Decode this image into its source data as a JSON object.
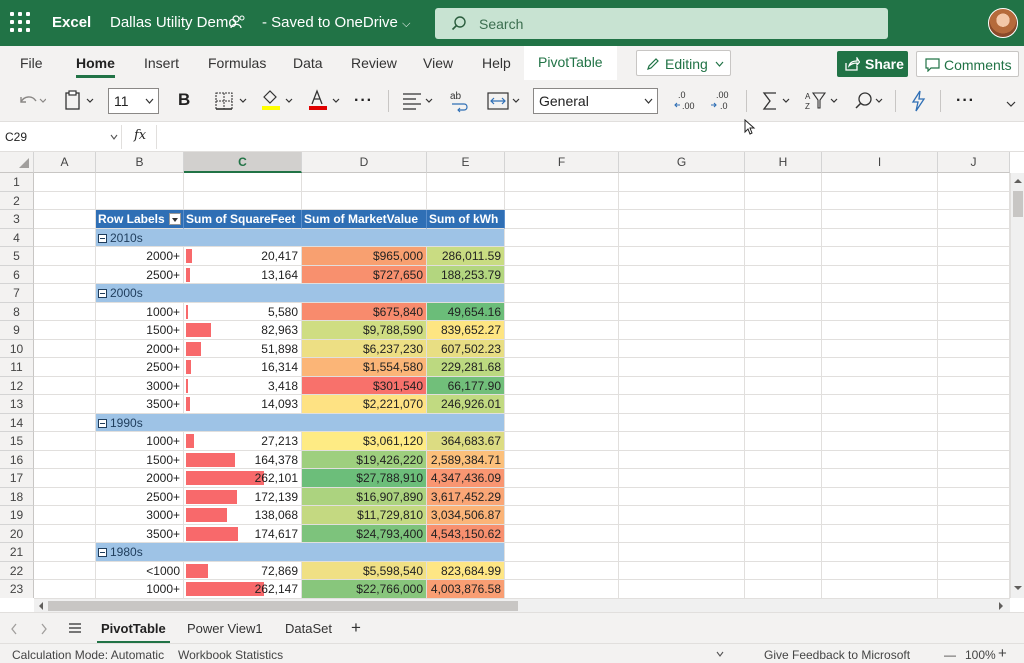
{
  "titlebar": {
    "app_name": "Excel",
    "doc_name": "Dallas Utility Demo",
    "doc_state": "- Saved to OneDrive",
    "search_placeholder": "Search"
  },
  "ribbon": {
    "tabs": [
      "File",
      "Home",
      "Insert",
      "Formulas",
      "Data",
      "Review",
      "View",
      "Help",
      "PivotTable"
    ],
    "active_tab": "Home",
    "editing_label": "Editing",
    "share_label": "Share",
    "comments_label": "Comments"
  },
  "toolbar": {
    "font_size": "11",
    "bold_label": "B",
    "number_format": "General",
    "more_label": "···"
  },
  "formula_bar": {
    "name_box": "C29",
    "fx_label": "fx",
    "formula": ""
  },
  "grid": {
    "columns": [
      "A",
      "B",
      "C",
      "D",
      "E",
      "F",
      "G",
      "H",
      "I",
      "J"
    ],
    "selected_column": "C",
    "row_numbers": [
      "1",
      "2",
      "3",
      "4",
      "5",
      "6",
      "7",
      "8",
      "9",
      "10",
      "11",
      "12",
      "13",
      "14",
      "15",
      "16",
      "17",
      "18",
      "19",
      "20",
      "21",
      "22",
      "23"
    ],
    "pivot_headers": [
      "Row Labels",
      "Sum of SquareFeet",
      "Sum of MarketValue",
      "Sum of kWh"
    ],
    "pivot_rows": [
      {
        "type": "group",
        "label": "2010s"
      },
      {
        "type": "data",
        "label": "2000+",
        "sqft": "20,417",
        "sqft_val": 20417,
        "mv": "$965,000",
        "mv_color": "#f8a070",
        "kwh": "286,011.59",
        "kwh_color": "#c9dc82"
      },
      {
        "type": "data",
        "label": "2500+",
        "sqft": "13,164",
        "sqft_val": 13164,
        "mv": "$727,650",
        "mv_color": "#f8906e",
        "kwh": "188,253.79",
        "kwh_color": "#b3d67f"
      },
      {
        "type": "group",
        "label": "2000s"
      },
      {
        "type": "data",
        "label": "1000+",
        "sqft": "5,580",
        "sqft_val": 5580,
        "mv": "$675,840",
        "mv_color": "#f88b6d",
        "kwh": "49,654.16",
        "kwh_color": "#6bbd79"
      },
      {
        "type": "data",
        "label": "1500+",
        "sqft": "82,963",
        "sqft_val": 82963,
        "mv": "$9,788,590",
        "mv_color": "#cfdd82",
        "kwh": "839,652.27",
        "kwh_color": "#fee582"
      },
      {
        "type": "data",
        "label": "2000+",
        "sqft": "51,898",
        "sqft_val": 51898,
        "mv": "$6,237,230",
        "mv_color": "#eddf84",
        "kwh": "607,502.23",
        "kwh_color": "#e8de83"
      },
      {
        "type": "data",
        "label": "2500+",
        "sqft": "16,314",
        "sqft_val": 16314,
        "mv": "$1,554,580",
        "mv_color": "#fbb577",
        "kwh": "229,281.68",
        "kwh_color": "#bcd980"
      },
      {
        "type": "data",
        "label": "3000+",
        "sqft": "3,418",
        "sqft_val": 3418,
        "mv": "$301,540",
        "mv_color": "#f8716b",
        "kwh": "66,177.90",
        "kwh_color": "#71bf7a"
      },
      {
        "type": "data",
        "label": "3500+",
        "sqft": "14,093",
        "sqft_val": 14093,
        "mv": "$2,221,070",
        "mv_color": "#fee283",
        "kwh": "246,926.01",
        "kwh_color": "#c1da81"
      },
      {
        "type": "group",
        "label": "1990s"
      },
      {
        "type": "data",
        "label": "1000+",
        "sqft": "27,213",
        "sqft_val": 27213,
        "mv": "$3,061,120",
        "mv_color": "#feeb84",
        "kwh": "364,683.67",
        "kwh_color": "#dcdc82"
      },
      {
        "type": "data",
        "label": "1500+",
        "sqft": "164,378",
        "sqft_val": 164378,
        "mv": "$19,426,220",
        "mv_color": "#9ecf7e",
        "kwh": "2,589,384.71",
        "kwh_color": "#fcc07b"
      },
      {
        "type": "data",
        "label": "2000+",
        "sqft": "262,101",
        "sqft_val": 262101,
        "mv": "$27,788,910",
        "mv_color": "#6cbe7a",
        "kwh": "4,347,436.09",
        "kwh_color": "#f99672"
      },
      {
        "type": "data",
        "label": "2500+",
        "sqft": "172,139",
        "sqft_val": 172139,
        "mv": "$16,907,890",
        "mv_color": "#acd37f",
        "kwh": "3,617,452.29",
        "kwh_color": "#faa676"
      },
      {
        "type": "data",
        "label": "3000+",
        "sqft": "138,068",
        "sqft_val": 138068,
        "mv": "$11,729,810",
        "mv_color": "#c4d981",
        "kwh": "3,034,506.87",
        "kwh_color": "#fbb478"
      },
      {
        "type": "data",
        "label": "3500+",
        "sqft": "174,617",
        "sqft_val": 174617,
        "mv": "$24,793,400",
        "mv_color": "#7dc37c",
        "kwh": "4,543,150.62",
        "kwh_color": "#f8906f"
      },
      {
        "type": "group",
        "label": "1980s"
      },
      {
        "type": "data",
        "label": "<1000",
        "sqft": "72,869",
        "sqft_val": 72869,
        "mv": "$5,598,540",
        "mv_color": "#f0e084",
        "kwh": "823,684.99",
        "kwh_color": "#fee684"
      },
      {
        "type": "data",
        "label": "1000+",
        "sqft": "262,147",
        "sqft_val": 262147,
        "mv": "$22,766,000",
        "mv_color": "#88c67c",
        "kwh": "4,003,876.58",
        "kwh_color": "#f99e73"
      }
    ],
    "databar_max": 262147,
    "databar_color": "#f8696b",
    "header_color": "#2f6fb5",
    "group_color": "#9ec3e6"
  },
  "sheet_tabs": {
    "tabs": [
      "PivotTable",
      "Power View1",
      "DataSet"
    ],
    "active": "PivotTable",
    "add_label": "+"
  },
  "statusbar": {
    "calc_mode": "Calculation Mode: Automatic",
    "workbook_stats": "Workbook Statistics",
    "feedback": "Give Feedback to Microsoft",
    "zoom_minus": "—",
    "zoom": "100%",
    "zoom_plus": "+"
  },
  "colors": {
    "brand": "#217346"
  }
}
